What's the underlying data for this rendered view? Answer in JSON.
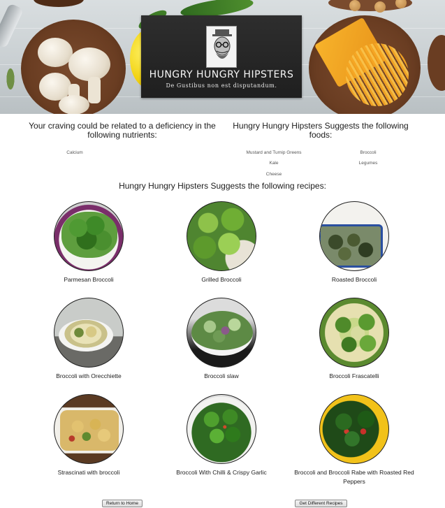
{
  "logo": {
    "title": "HUNGRY HUNGRY HIPSTERS",
    "tagline": "De Gustibus non est disputandum."
  },
  "nutrients": {
    "heading": "Your craving could be related to a deficiency in the following nutrients:",
    "items": [
      "Calcium"
    ]
  },
  "foods": {
    "heading": "Hungry Hungry Hipsters Suggests the following foods:",
    "items": [
      "Mustard and Turnip Greens",
      "Broccoli",
      "Kale",
      "Legumes",
      "Cheese"
    ]
  },
  "recipes": {
    "heading": "Hungry Hungry Hipsters Suggests the following recipes:",
    "items": [
      {
        "name": "Parmesan Broccoli",
        "icon": "broccoli-photo"
      },
      {
        "name": "Grilled Broccoli",
        "icon": "broccoli-photo"
      },
      {
        "name": "Roasted Broccoli",
        "icon": "broccoli-photo"
      },
      {
        "name": "Broccoli with Orecchiette",
        "icon": "pasta-photo"
      },
      {
        "name": "Broccoli slaw",
        "icon": "slaw-photo"
      },
      {
        "name": "Broccoli Frascatelli",
        "icon": "broccoli-photo"
      },
      {
        "name": "Strascinati with broccoli",
        "icon": "pasta-photo"
      },
      {
        "name": "Broccoli With Chilli & Crispy Garlic",
        "icon": "broccoli-photo"
      },
      {
        "name": "Broccoli and Broccoli Rabe with Roasted Red Peppers",
        "icon": "broccoli-rabe-photo"
      }
    ]
  },
  "buttons": {
    "home": "Return to Home",
    "different": "Get Different Recipes"
  },
  "colors": {
    "logo_bg": "#242424",
    "broccoli": "#3f7a25",
    "accent_text": "#1c1c1c"
  }
}
